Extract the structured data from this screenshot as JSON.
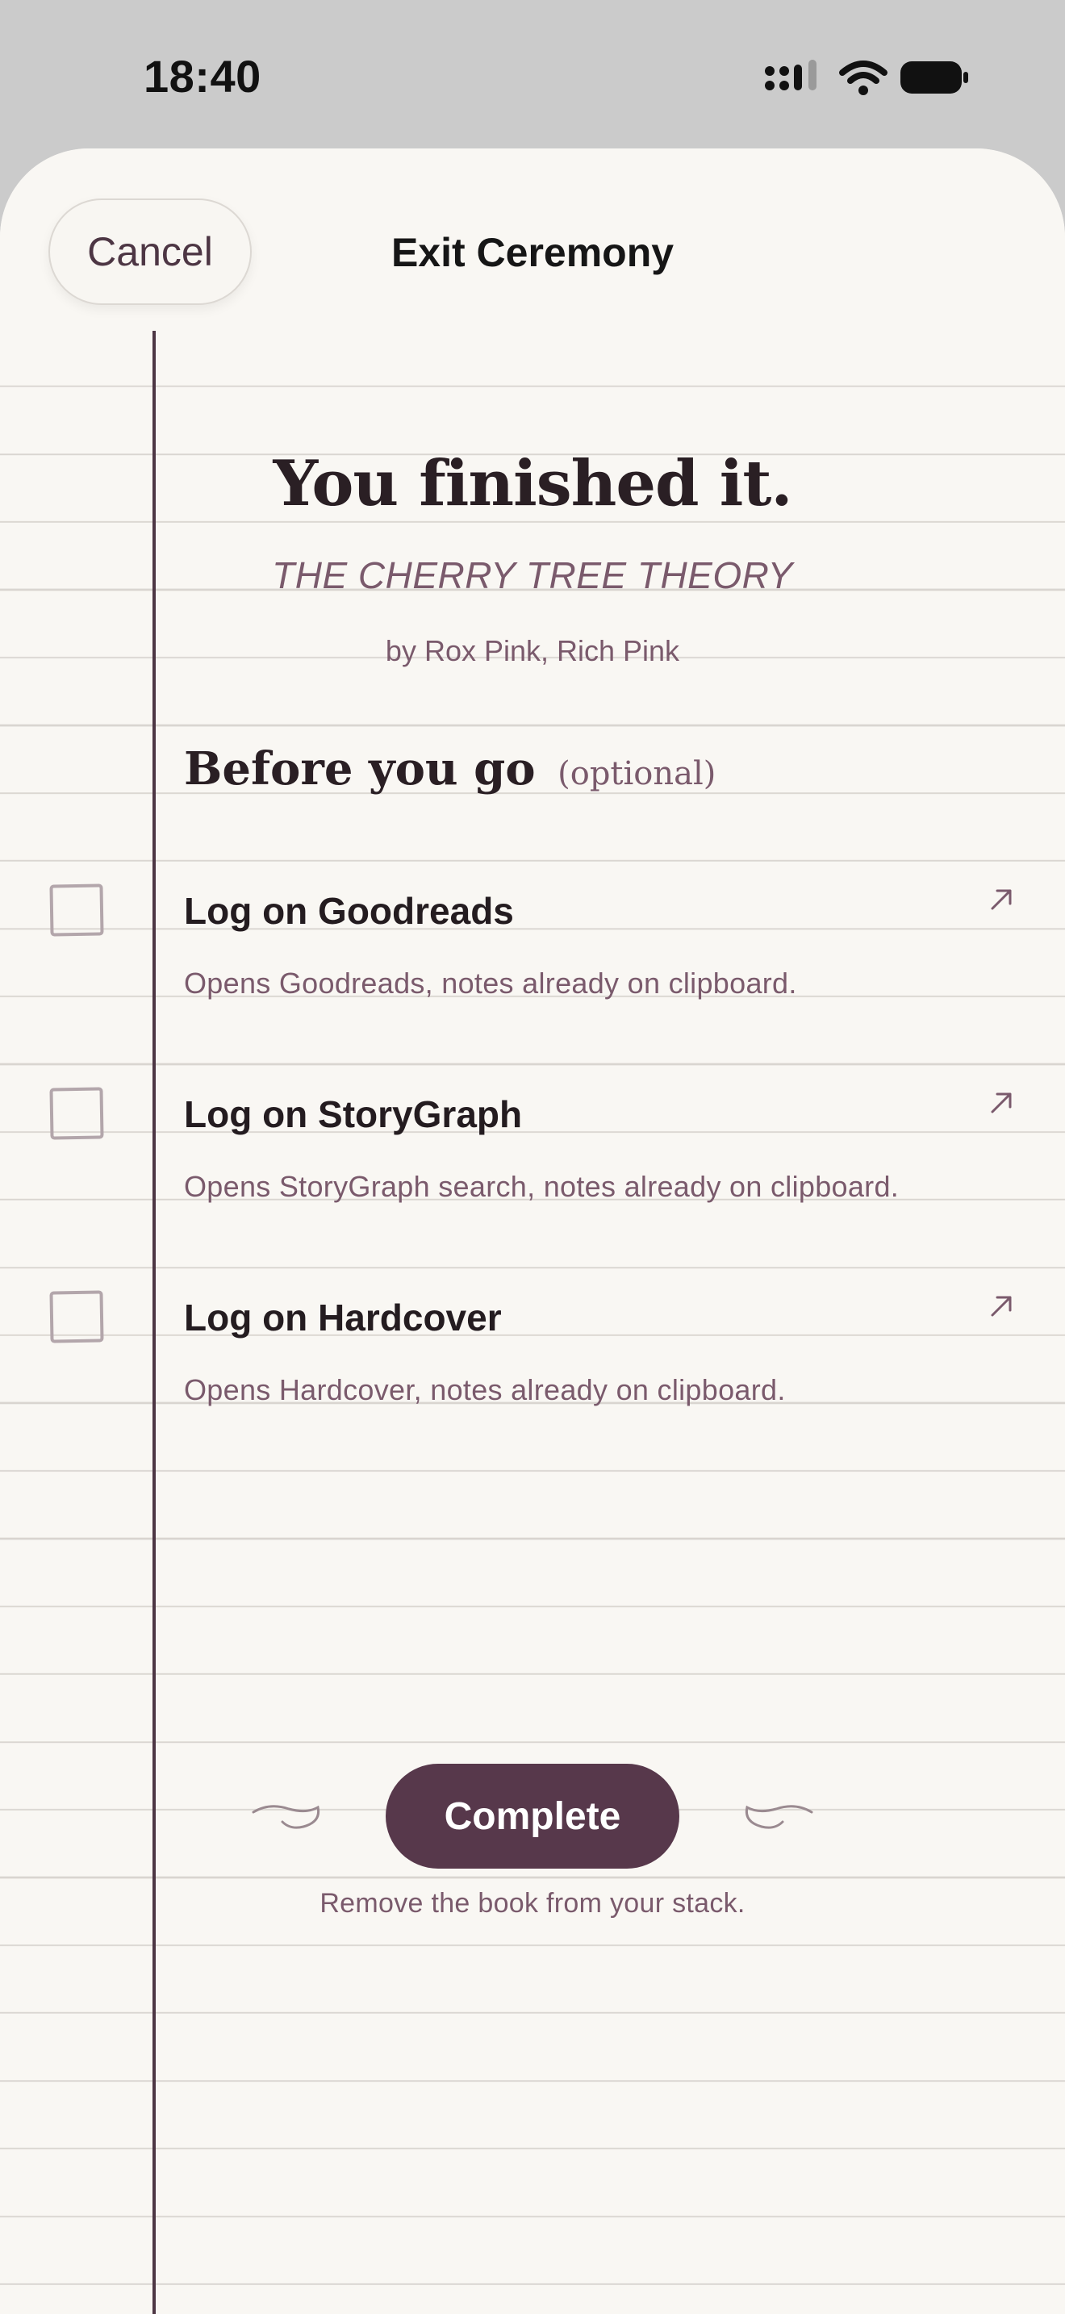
{
  "status_bar": {
    "time": "18:40",
    "icons": [
      "cellular-signal-icon",
      "wifi-icon",
      "battery-icon"
    ]
  },
  "header": {
    "cancel_label": "Cancel",
    "title": "Exit Ceremony"
  },
  "book": {
    "headline": "You finished it.",
    "title": "THE CHERRY TREE THEORY",
    "author": "by Rox Pink, Rich Pink"
  },
  "before_you_go": {
    "heading": "Before you go",
    "optional": "(optional)",
    "items": [
      {
        "title": "Log on Goodreads",
        "description": "Opens Goodreads, notes already on clipboard.",
        "checked": false,
        "icon": "external-arrow-icon"
      },
      {
        "title": "Log on StoryGraph",
        "description": "Opens StoryGraph search, notes already on clipboard.",
        "checked": false,
        "icon": "external-arrow-icon"
      },
      {
        "title": "Log on Hardcover",
        "description": "Opens Hardcover, notes already on clipboard.",
        "checked": false,
        "icon": "external-arrow-icon"
      }
    ]
  },
  "complete": {
    "label": "Complete",
    "caption": "Remove the book from your stack."
  },
  "colors": {
    "accent": "#57384B",
    "muted_text": "#7A5A6C",
    "paper": "#F9F7F3",
    "rule_line": "#D9D5D0",
    "background": "#CBCBCB"
  }
}
